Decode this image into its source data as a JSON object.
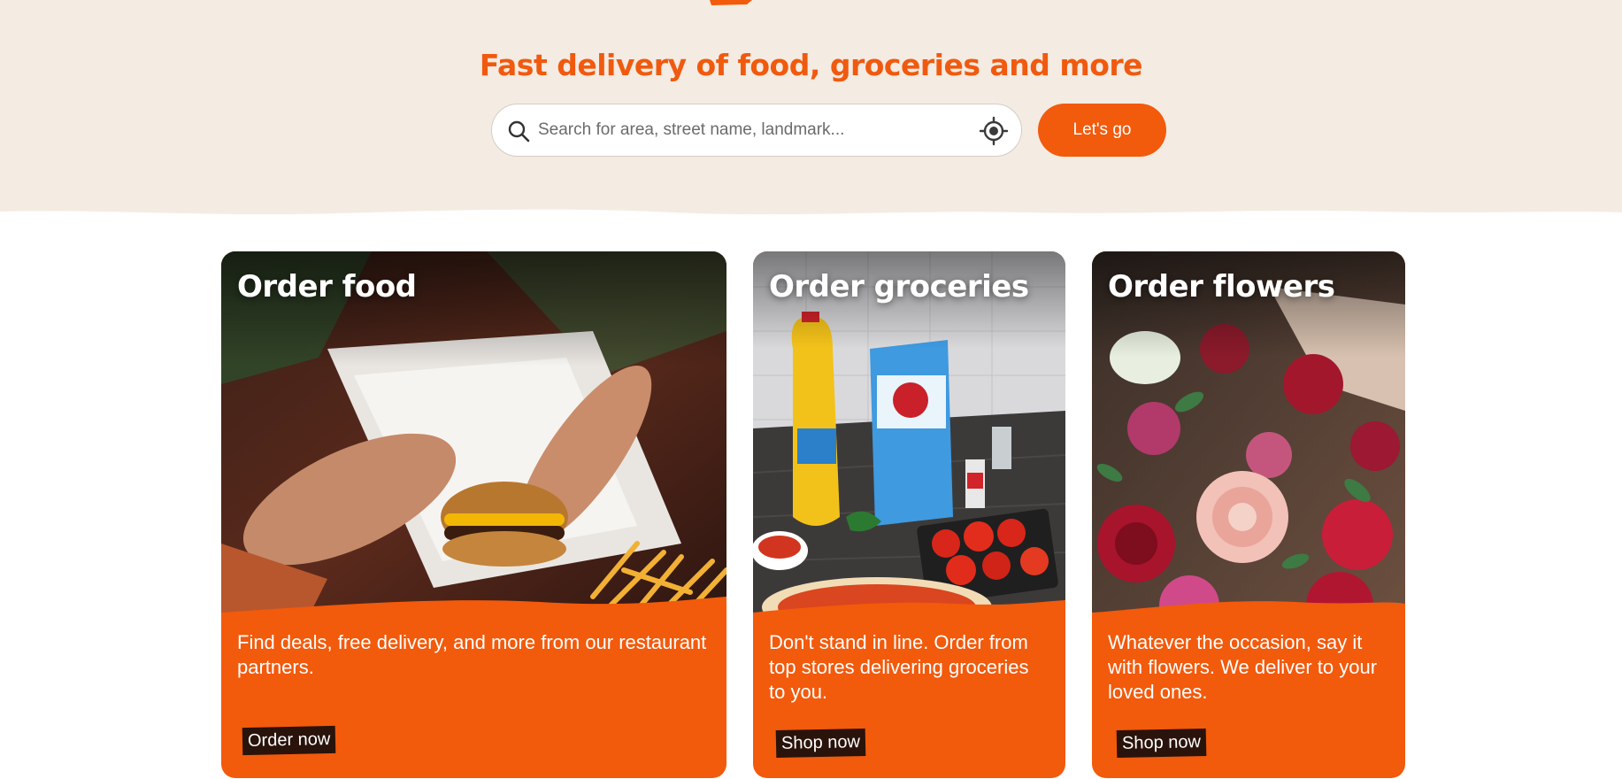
{
  "hero": {
    "headline": "Fast delivery of food, groceries and more",
    "background_color": "#f4ebe2",
    "accent_color": "#f25a0c"
  },
  "search": {
    "placeholder": "Search for area, street name, landmark...",
    "value": "",
    "submit_label": "Let's go"
  },
  "cards": [
    {
      "title": "Order food",
      "description": "Find deals, free delivery, and more from our restaurant partners.",
      "cta": "Order now",
      "photo": "burger-and-fries-photo"
    },
    {
      "title": "Order groceries",
      "description": "Don't stand in line. Order from top stores delivering groceries to you.",
      "cta": "Shop now",
      "photo": "grocery-items-photo"
    },
    {
      "title": "Order flowers",
      "description": "Whatever the occasion, say it with flowers. We deliver to your loved ones.",
      "cta": "Shop now",
      "photo": "flower-bouquet-photo"
    }
  ]
}
